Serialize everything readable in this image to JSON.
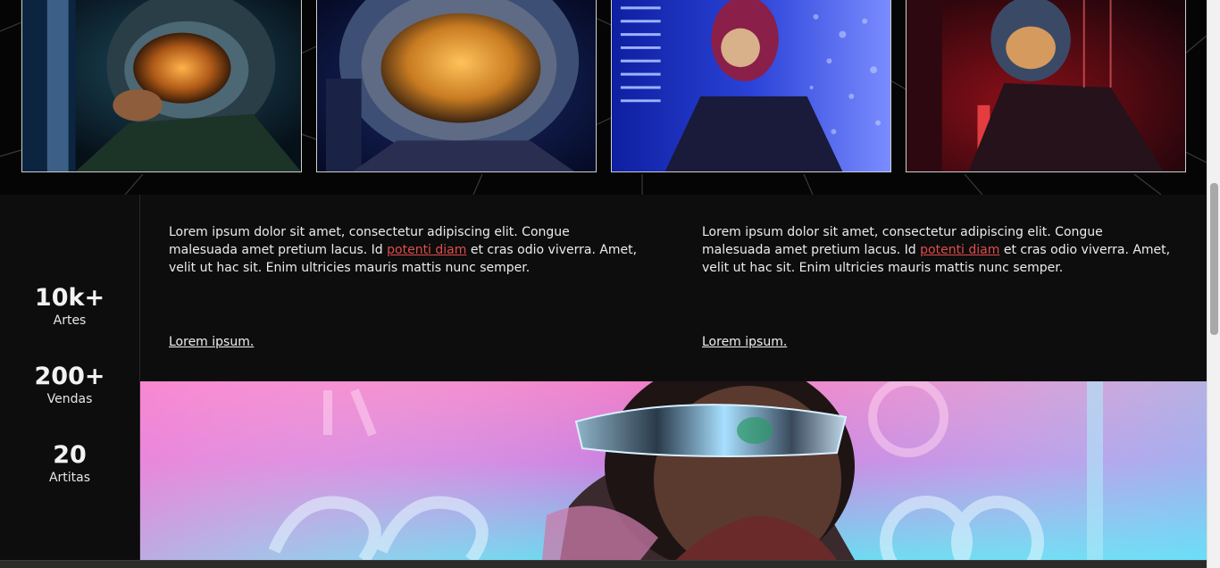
{
  "gallery": {
    "images": [
      {
        "name": "astronaut-woman-gold-visor"
      },
      {
        "name": "astronaut-woman-lit-visor"
      },
      {
        "name": "pilot-red-helmet-blue"
      },
      {
        "name": "astronaut-red-neon"
      }
    ]
  },
  "stats": [
    {
      "value": "10k+",
      "label": "Artes"
    },
    {
      "value": "200+",
      "label": "Vendas"
    },
    {
      "value": "20",
      "label": "Artitas"
    }
  ],
  "columns": [
    {
      "text_before": "Lorem ipsum dolor sit amet, consectetur adipiscing elit. Congue malesuada amet pretium lacus. Id ",
      "link": "potenti diam",
      "text_after": " et cras odio viverra. Amet, velit ut hac sit. Enim ultricies mauris mattis nunc semper.",
      "read_more": "Lorem ipsum."
    },
    {
      "text_before": "Lorem ipsum dolor sit amet, consectetur adipiscing elit. Congue malesuada amet pretium lacus. Id ",
      "link": "potenti diam",
      "text_after": " et cras odio viverra. Amet, velit ut hac sit. Enim ultricies mauris mattis nunc semper.",
      "read_more": "Lorem ipsum."
    }
  ],
  "hero": {
    "name": "cyberpunk-visor-portrait"
  },
  "colors": {
    "accent_link": "#e14b4b",
    "background": "#0d0d0d"
  }
}
